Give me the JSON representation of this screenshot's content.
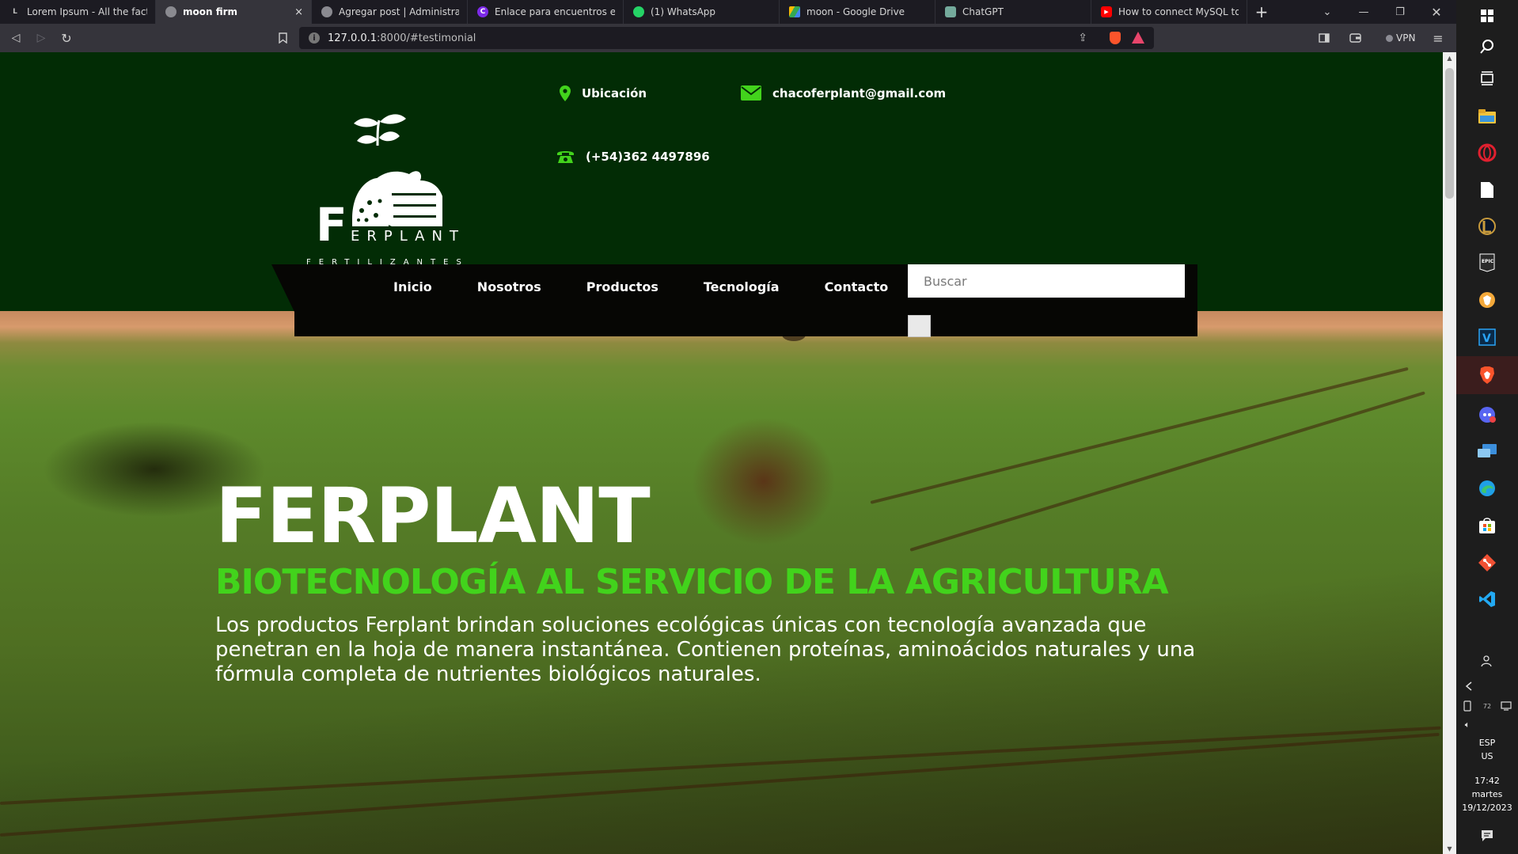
{
  "browser": {
    "tabs": [
      {
        "title": "Lorem Ipsum - All the facts - Li",
        "icon": "lorem-ipsum-favicon",
        "active": false
      },
      {
        "title": "moon firm",
        "icon": "globe-favicon",
        "active": true,
        "close": "×"
      },
      {
        "title": "Agregar post | Administración",
        "icon": "globe-favicon",
        "active": false
      },
      {
        "title": "Enlace para encuentros en vivo",
        "icon": "canva-favicon",
        "active": false
      },
      {
        "title": "(1) WhatsApp",
        "icon": "whatsapp-favicon",
        "active": false
      },
      {
        "title": "moon - Google Drive",
        "icon": "google-drive-favicon",
        "active": false
      },
      {
        "title": "ChatGPT",
        "icon": "chatgpt-favicon",
        "active": false
      },
      {
        "title": "How to connect MySQL to Django",
        "icon": "youtube-favicon",
        "active": false
      }
    ],
    "new_tab": "+",
    "url_host": "127.0.0.1",
    "url_rest": ":8000/#testimonial",
    "vpn_label": "VPN"
  },
  "site": {
    "logo": {
      "mark": "F",
      "name": "ERPLANT",
      "tagline": "FERTILIZANTES"
    },
    "contact": {
      "location": "Ubicación",
      "email": "chacoferplant@gmail.com",
      "phone": "(+54)362 4497896"
    },
    "nav": [
      "Inicio",
      "Nosotros",
      "Productos",
      "Tecnología",
      "Contacto"
    ],
    "search_placeholder": "Buscar",
    "hero": {
      "title": "FERPLANT",
      "subtitle": "BIOTECNOLOGÍA AL SERVICIO DE LA AGRICULTURA",
      "description": "Los productos Ferplant brindan soluciones ecológicas únicas con tecnología avanzada que penetran en la hoja de manera instantánea. Contienen proteínas, aminoácidos naturales y una fórmula completa de nutrientes biológicos naturales."
    },
    "colors": {
      "header_bg": "#022c05",
      "nav_bg": "#060604",
      "accent_green": "#42d31c"
    }
  },
  "taskbar": {
    "language": "ESP",
    "layout": "US",
    "time": "17:42",
    "day": "martes",
    "date": "19/12/2023",
    "badge": "72"
  }
}
